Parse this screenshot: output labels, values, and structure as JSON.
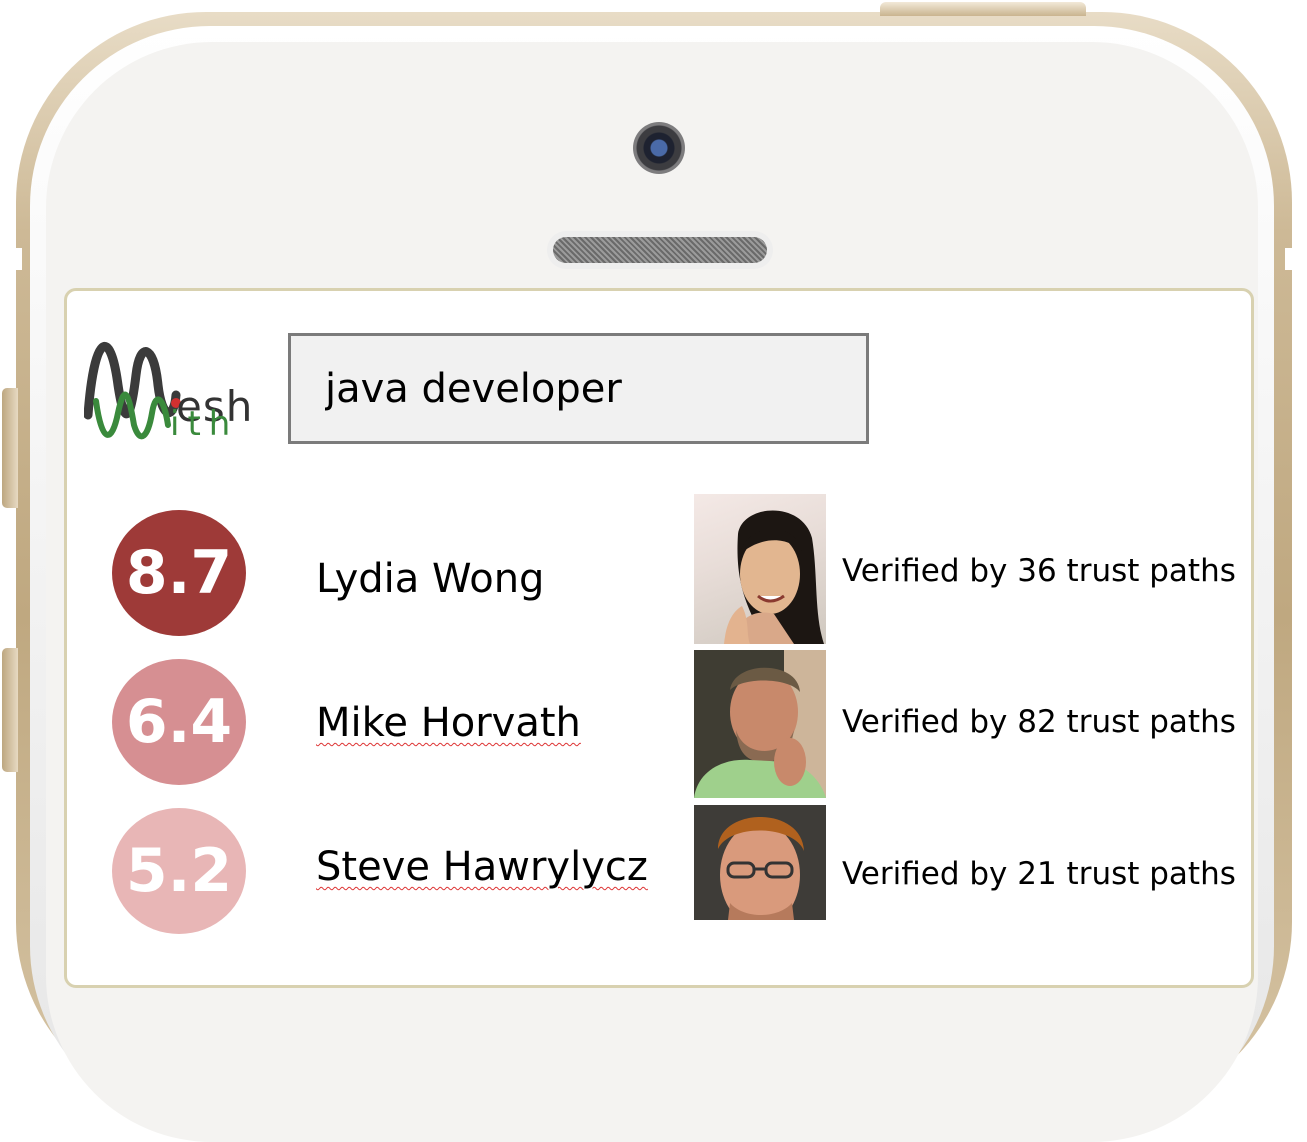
{
  "logo": {
    "mesh": "esh",
    "with": "ith"
  },
  "search": {
    "value": "java developer"
  },
  "results": [
    {
      "score": "8.7",
      "score_color": "#9e3a38",
      "name": "Lydia Wong",
      "verified": "Verified by 36 trust paths",
      "photo_icon": "portrait-woman"
    },
    {
      "score": "6.4",
      "score_color": "#d68f92",
      "name": "Mike Horvath",
      "verified": "Verified by 82 trust paths",
      "photo_icon": "portrait-man-beard"
    },
    {
      "score": "5.2",
      "score_color": "#e8b6b6",
      "name": "Steve Hawrylycz",
      "verified": "Verified by 21 trust paths",
      "photo_icon": "portrait-man-glasses"
    }
  ]
}
